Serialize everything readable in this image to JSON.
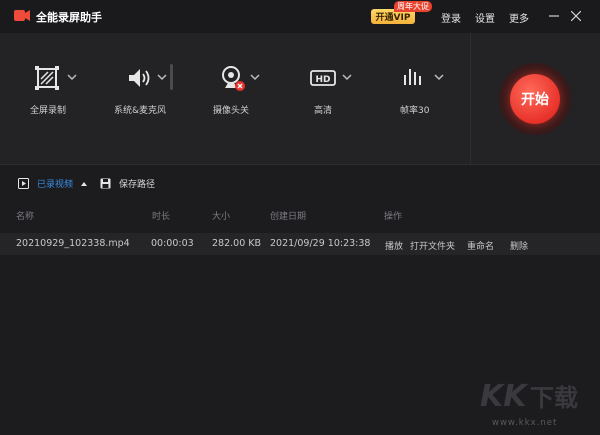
{
  "app": {
    "title": "全能录屏助手"
  },
  "titlebar": {
    "vip_label": "开通VIP",
    "vip_badge": "周年大促",
    "login": "登录",
    "settings": "设置",
    "more": "更多"
  },
  "toolbar": {
    "fullscreen": "全屏录制",
    "audio": "系统&麦克风",
    "camera": "摄像头关",
    "quality": "高清",
    "framerate": "帧率30",
    "start": "开始"
  },
  "tabs": {
    "recorded": "已录视频",
    "save_path": "保存路径"
  },
  "table": {
    "headers": {
      "name": "名称",
      "duration": "时长",
      "size": "大小",
      "created": "创建日期",
      "actions": "操作"
    },
    "rows": [
      {
        "name": "20210929_102338.mp4",
        "duration": "00:00:03",
        "size": "282.00 KB",
        "created": "2021/09/29 10:23:38",
        "play": "播放",
        "open_folder": "打开文件夹",
        "rename": "重命名",
        "delete": "删除"
      }
    ]
  },
  "watermark": {
    "logo_text": "KK下载",
    "url": "www.kkx.net"
  },
  "colors": {
    "accent": "#3a8ee6",
    "record_red": "#e8322a",
    "vip_gold": "#f3b23a"
  }
}
